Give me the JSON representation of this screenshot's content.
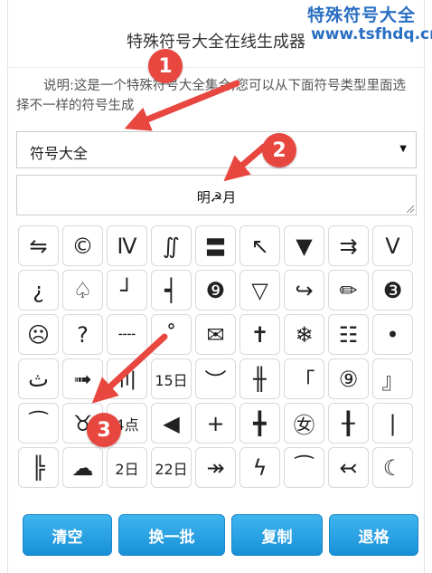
{
  "watermark": {
    "line1": "特殊符号大全",
    "line2": "www.tsfhdq.cn"
  },
  "header": {
    "title": "特殊符号大全在线生成器"
  },
  "description": "说明:这是一个特殊符号大全集合,您可以从下面符号类型里面选择不一样的符号生成",
  "category_select": {
    "value": "符号大全"
  },
  "output": {
    "value": "明☭月"
  },
  "symbols": [
    "⇋",
    "©",
    "Ⅳ",
    "∬",
    "〓",
    "↖",
    "▼",
    "⇉",
    "Ⅴ",
    "¿",
    "♤",
    "┘",
    "┥",
    "❾",
    "▽",
    "↪",
    "✏",
    "❸",
    "☹",
    "?",
    "╌╌",
    "˚",
    "✉",
    "✝",
    "❄",
    "☷",
    "•",
    "ث",
    "➟",
    "〣",
    "15日",
    "︶",
    "╫",
    "「",
    "⑨",
    "』",
    "⁀",
    "♉",
    "4点",
    "◀",
    "+",
    "╋",
    "㊛",
    "╂",
    "|",
    "╠",
    "☁",
    "2日",
    "22日",
    "↠",
    "ϟ",
    "⁀",
    "↢",
    "☾"
  ],
  "buttons": {
    "clear": "清空",
    "refresh": "换一批",
    "copy": "复制",
    "backspace": "退格"
  },
  "annotations": [
    "1",
    "2",
    "3"
  ],
  "colors": {
    "button_blue": "#1e95dc",
    "annotation_red": "#e8473f",
    "watermark_blue": "#2a6fc2"
  }
}
